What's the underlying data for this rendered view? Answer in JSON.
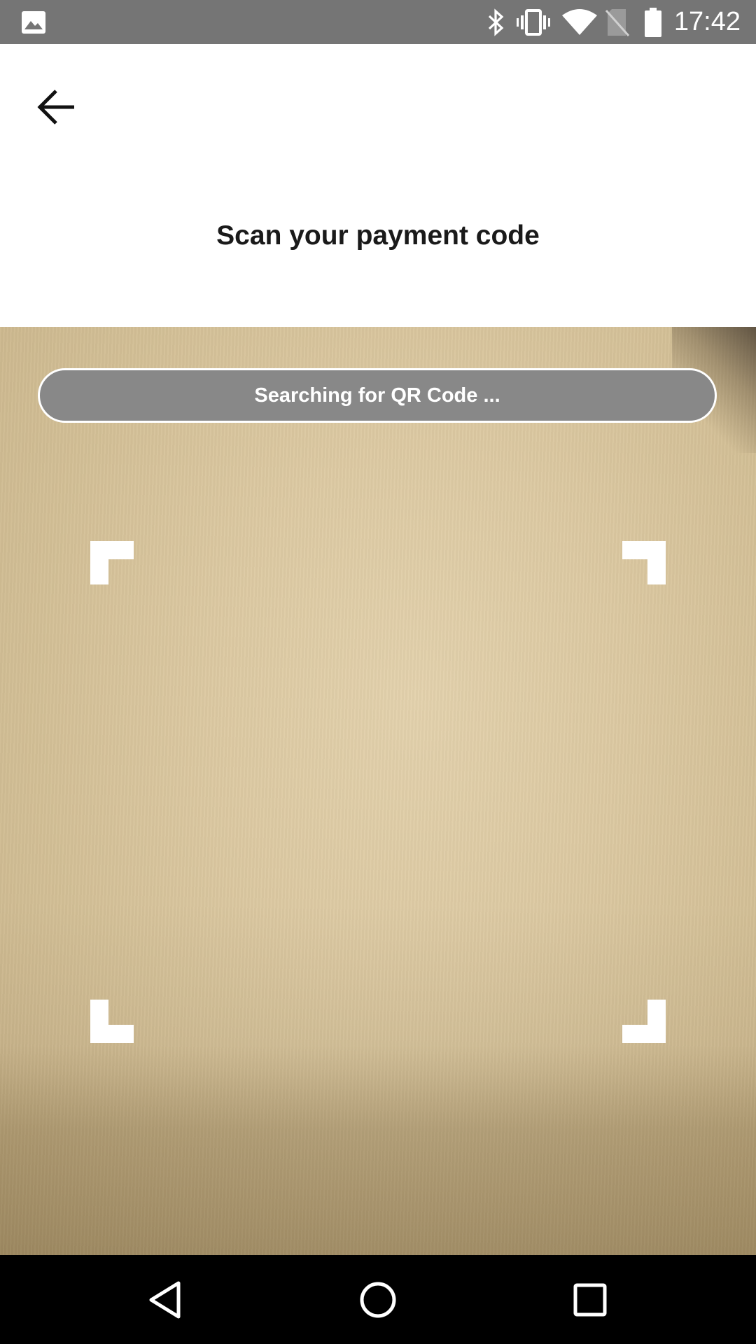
{
  "status_bar": {
    "time": "17:42",
    "icons": [
      "image-notification-icon",
      "bluetooth-icon",
      "vibrate-icon",
      "wifi-icon",
      "no-sim-icon",
      "battery-icon"
    ]
  },
  "header": {
    "back_icon": "arrow-left-icon",
    "title": "Scan your payment code"
  },
  "scanner": {
    "status_text": "Searching for QR Code ...",
    "pill_color": "#888888",
    "frame_color": "#ffffff"
  },
  "nav_bar": {
    "buttons": [
      "back-triangle-icon",
      "home-circle-icon",
      "recents-square-icon"
    ]
  }
}
